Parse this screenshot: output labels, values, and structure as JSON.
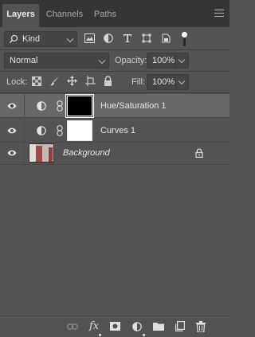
{
  "tabs": [
    {
      "label": "Layers",
      "active": true
    },
    {
      "label": "Channels",
      "active": false
    },
    {
      "label": "Paths",
      "active": false
    }
  ],
  "filter": {
    "kind_label": "Kind",
    "icons": [
      "pixel-filter-icon",
      "adjustment-filter-icon",
      "type-filter-icon",
      "shape-filter-icon",
      "smart-object-filter-icon",
      "filter-toggle-icon"
    ]
  },
  "blend": {
    "mode": "Normal",
    "opacity_label": "Opacity:",
    "opacity_value": "100%"
  },
  "lock": {
    "label": "Lock:",
    "icons": [
      "lock-transparent-pixels-icon",
      "lock-image-pixels-icon",
      "lock-position-icon",
      "lock-artboard-icon",
      "lock-all-icon"
    ],
    "fill_label": "Fill:",
    "fill_value": "100%"
  },
  "layers": [
    {
      "name": "Hue/Saturation 1",
      "type": "adjustment",
      "mask": "black",
      "selected": true,
      "visible": true
    },
    {
      "name": "Curves 1",
      "type": "adjustment",
      "mask": "white",
      "selected": false,
      "visible": true
    },
    {
      "name": "Background",
      "type": "background",
      "locked": true,
      "selected": false,
      "visible": true
    }
  ],
  "bottom_icons": [
    "link-layers-icon",
    "fx-icon",
    "add-mask-icon",
    "new-adjustment-icon",
    "new-group-icon",
    "new-layer-icon",
    "delete-icon"
  ],
  "colors": {
    "panel": "#535353",
    "tabbar": "#353535",
    "selected_row": "#686868"
  }
}
